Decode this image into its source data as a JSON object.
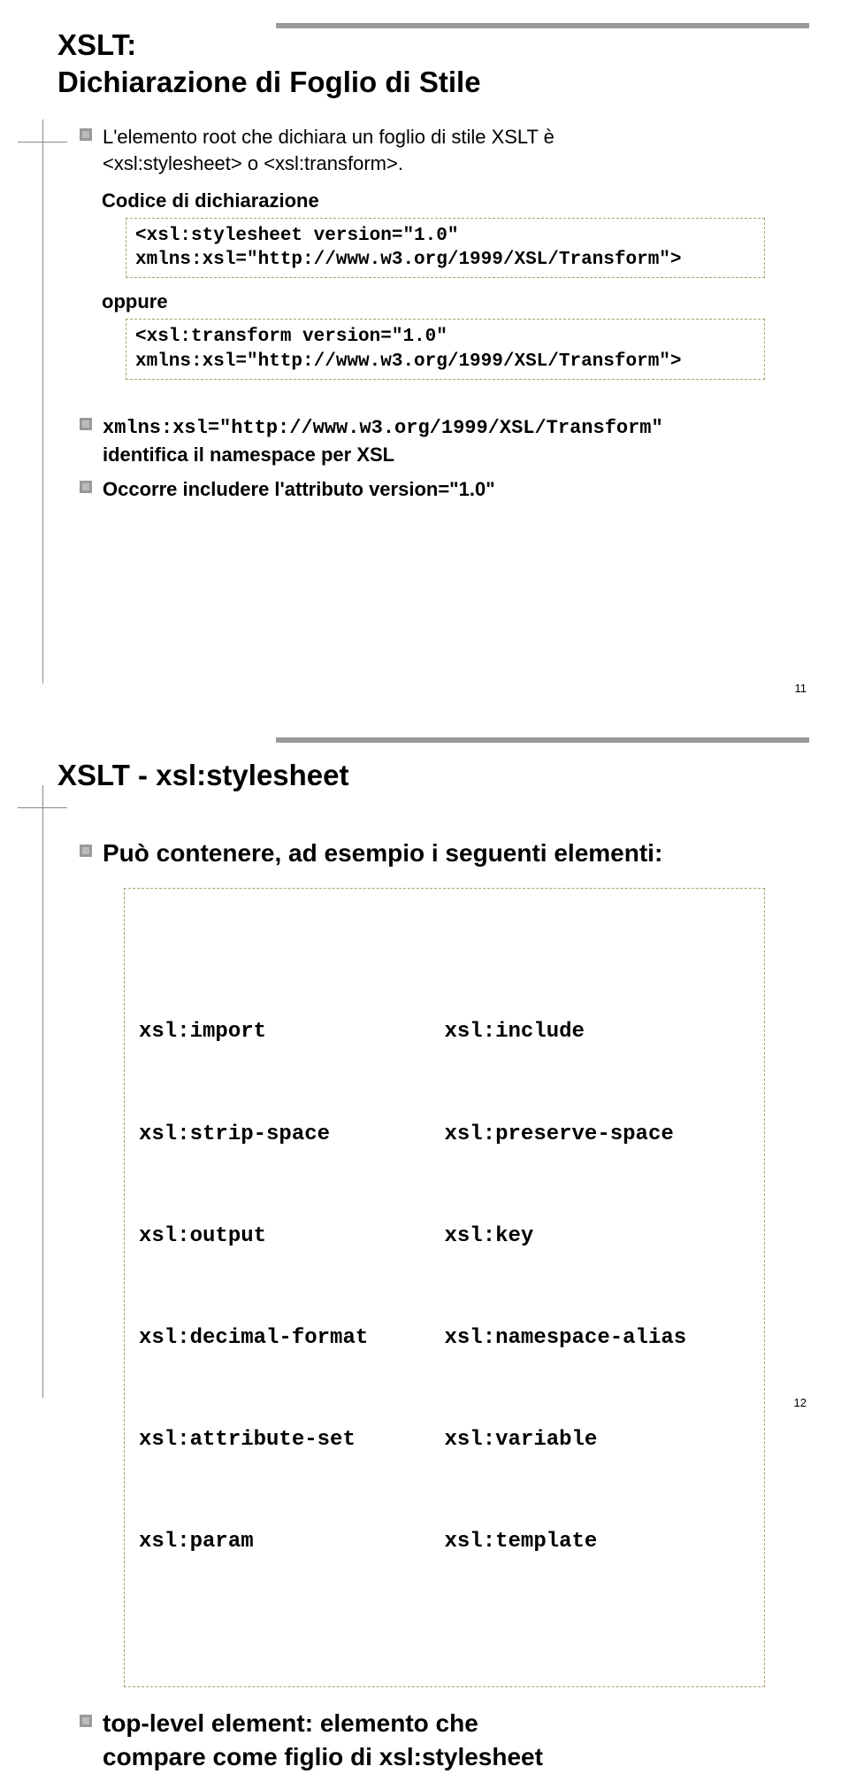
{
  "slide1": {
    "title_line1": "XSLT:",
    "title_line2": "Dichiarazione di Foglio di Stile",
    "bullet1a": "L'elemento root che dichiara un foglio di stile XSLT è",
    "bullet1b": "<xsl:stylesheet> o <xsl:transform>.",
    "sub1": "Codice di dichiarazione",
    "code1": "<xsl:stylesheet version=\"1.0\"\nxmlns:xsl=\"http://www.w3.org/1999/XSL/Transform\">",
    "sub2": "oppure",
    "code2": "<xsl:transform version=\"1.0\"\nxmlns:xsl=\"http://www.w3.org/1999/XSL/Transform\">",
    "bullet2a": "xmlns:xsl=\"http://www.w3.org/1999/XSL/Transform\"",
    "bullet2b": "identifica il namespace per XSL",
    "bullet3": "Occorre includere l'attributo version=\"1.0\"",
    "pagenum": "11"
  },
  "slide2": {
    "title": "XSLT - xsl:stylesheet",
    "bullet1": "Può contenere, ad esempio i seguenti elementi:",
    "col1": {
      "i0": "xsl:import",
      "i1": "xsl:strip-space",
      "i2": "xsl:output",
      "i3": "xsl:decimal-format",
      "i4": "xsl:attribute-set",
      "i5": "xsl:param"
    },
    "col2": {
      "i0": "xsl:include",
      "i1": "xsl:preserve-space",
      "i2": "xsl:key",
      "i3": "xsl:namespace-alias",
      "i4": "xsl:variable",
      "i5": "xsl:template"
    },
    "bullet2a": "top-level element: elemento che",
    "bullet2b": "compare come figlio di xsl:stylesheet",
    "pagenum": "12"
  }
}
